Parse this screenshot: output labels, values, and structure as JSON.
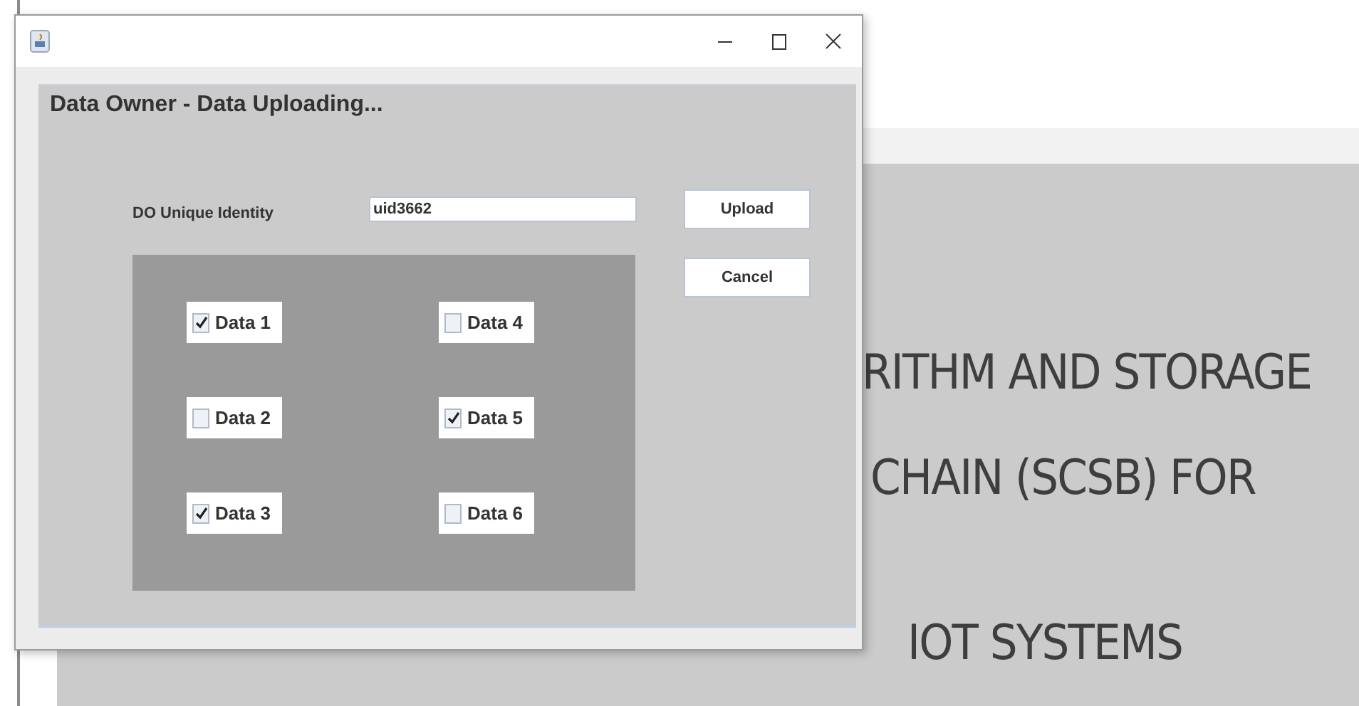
{
  "background_page": {
    "heading_lines": [
      "RITHM AND STORAGE",
      "CHAIN (SCSB) FOR",
      "IOT SYSTEMS"
    ]
  },
  "window": {
    "heading": "Data Owner - Data Uploading...",
    "identity": {
      "label": "DO Unique Identity",
      "value": "uid3662"
    },
    "buttons": [
      "Upload",
      "Cancel"
    ],
    "checkboxes": [
      {
        "label": "Data 1",
        "checked": true
      },
      {
        "label": "Data 4",
        "checked": false
      },
      {
        "label": "Data 2",
        "checked": false
      },
      {
        "label": "Data 5",
        "checked": true
      },
      {
        "label": "Data 3",
        "checked": true
      },
      {
        "label": "Data 6",
        "checked": false
      }
    ]
  }
}
